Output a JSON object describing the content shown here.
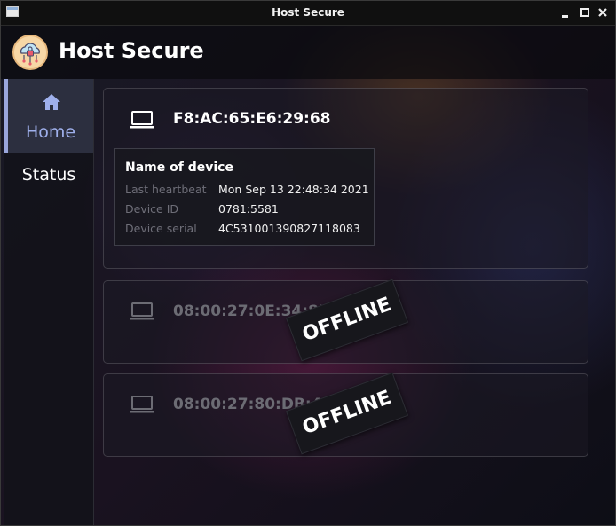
{
  "window": {
    "title": "Host Secure"
  },
  "app": {
    "title": "Host Secure",
    "logo_icon": "cloud-lock-icon"
  },
  "sidebar": {
    "items": [
      {
        "label": "Home",
        "icon": "home-icon",
        "selected": true
      },
      {
        "label": "Status",
        "selected": false
      }
    ]
  },
  "devices": [
    {
      "mac": "F8:AC:65:E6:29:68",
      "icon": "laptop-icon",
      "online": true,
      "details": {
        "heading": "Name of device",
        "rows": [
          {
            "label": "Last heartbeat",
            "value": "Mon Sep 13 22:48:34 2021"
          },
          {
            "label": "Device ID",
            "value": "0781:5581"
          },
          {
            "label": "Device serial",
            "value": "4C531001390827118083"
          }
        ]
      }
    },
    {
      "mac": "08:00:27:0E:34:8D",
      "icon": "laptop-icon",
      "online": false,
      "badge": "OFFLINE"
    },
    {
      "mac": "08:00:27:80:DB:4A",
      "icon": "laptop-icon",
      "online": false,
      "badge": "OFFLINE"
    }
  ],
  "colors": {
    "accent": "#9fb0ec",
    "offline_text": "#6c6c74"
  }
}
